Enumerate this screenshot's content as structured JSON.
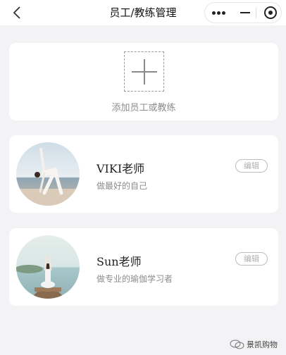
{
  "navbar": {
    "title": "员工/教练管理",
    "back_icon": "chevron-left-icon",
    "more_icon": "more-dots-icon",
    "minimize_icon": "minimize-icon",
    "close_icon": "target-close-icon"
  },
  "add_card": {
    "icon": "plus-icon",
    "label": "添加员工或教练"
  },
  "staff": [
    {
      "name": "VIKI老师",
      "motto": "做最好的自己",
      "edit_label": "编辑",
      "avatar": "yoga-triangle-pose-photo"
    },
    {
      "name": "Sun老师",
      "motto": "做专业的瑜伽学习者",
      "edit_label": "编辑",
      "avatar": "yoga-meditation-pier-photo"
    }
  ],
  "watermark": {
    "text": "景凯购物",
    "icon": "wechat-icon"
  },
  "colors": {
    "background": "#f3f3f5",
    "card": "#ffffff",
    "muted_text": "#8c8c8c"
  }
}
